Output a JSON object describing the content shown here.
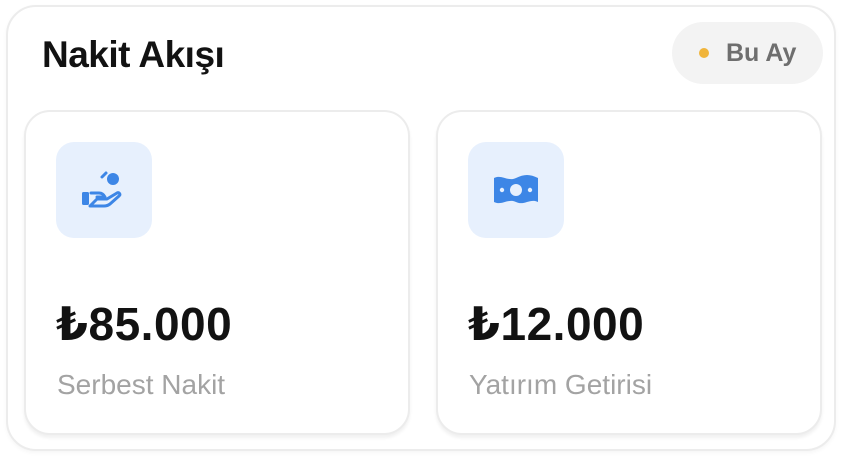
{
  "widget": {
    "title": "Nakit Akışı",
    "period": {
      "label": "Bu Ay",
      "dot_color": "#f0b43a"
    }
  },
  "stats": [
    {
      "icon": "hand-coin-icon",
      "value": "₺85.000",
      "label": "Serbest Nakit"
    },
    {
      "icon": "banknote-icon",
      "value": "₺12.000",
      "label": "Yatırım Getirisi"
    }
  ],
  "colors": {
    "accent": "#3d86e6",
    "icon_bg": "#e7f0fd",
    "muted_text": "#a3a3a3"
  }
}
